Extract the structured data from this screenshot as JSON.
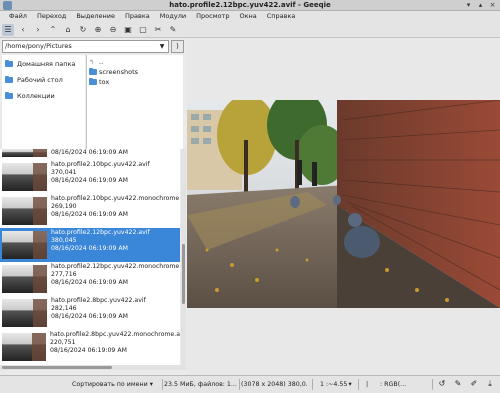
{
  "window": {
    "title": "hato.profile2.12bpc.yuv422.avif - Geeqie",
    "controls": [
      "▾",
      "▴",
      "×"
    ]
  },
  "menubar": {
    "items": [
      "Файл",
      "Переход",
      "Выделение",
      "Правка",
      "Модули",
      "Просмотр",
      "Окна",
      "Справка"
    ]
  },
  "toolbar": {
    "icons": [
      "thumbnails-toggle-icon",
      "back-icon",
      "forward-icon",
      "up-icon",
      "home-icon",
      "refresh-icon",
      "zoom-in-icon",
      "zoom-out-icon",
      "zoom-fit-icon",
      "zoom-1-1-icon",
      "tools-icon",
      "pin-icon"
    ]
  },
  "path": {
    "value": "/home/pony/Pictures"
  },
  "places": {
    "items": [
      "Домашняя папка",
      "Рабочий стол",
      "Коллекции"
    ]
  },
  "dirs": {
    "parent": "..",
    "items": [
      "screenshots",
      "tox"
    ]
  },
  "files": {
    "partial_top": {
      "name": "",
      "date": "08/16/2024 06:19:09 AM"
    },
    "items": [
      {
        "name": "hato.profile2.10bpc.yuv422.avif",
        "size": "370,041",
        "date": "08/16/2024 06:19:09 AM",
        "selected": false
      },
      {
        "name": "hato.profile2.10bpc.yuv422.monochrome",
        "size": "269,190",
        "date": "08/16/2024 06:19:09 AM",
        "selected": false
      },
      {
        "name": "hato.profile2.12bpc.yuv422.avif",
        "size": "380,045",
        "date": "08/16/2024 06:19:09 AM",
        "selected": true
      },
      {
        "name": "hato.profile2.12bpc.yuv422.monochrome",
        "size": "277,716",
        "date": "08/16/2024 06:19:09 AM",
        "selected": false
      },
      {
        "name": "hato.profile2.8bpc.yuv422.avif",
        "size": "282,146",
        "date": "08/16/2024 06:19:09 AM",
        "selected": false
      },
      {
        "name": "hato.profile2.8bpc.yuv422.monochrome.a",
        "size": "220,751",
        "date": "08/16/2024 06:19:09 AM",
        "selected": false
      }
    ]
  },
  "statusbar": {
    "sort": "Сортировать по имени",
    "files": "23.5 МиБ, файлов: 1...",
    "dimensions": "(3078 x 2048) 380,0...",
    "zoom": "1 :~4.55",
    "pipe": "|",
    "colorinfo": ": RGB(...",
    "caret": "▾"
  }
}
